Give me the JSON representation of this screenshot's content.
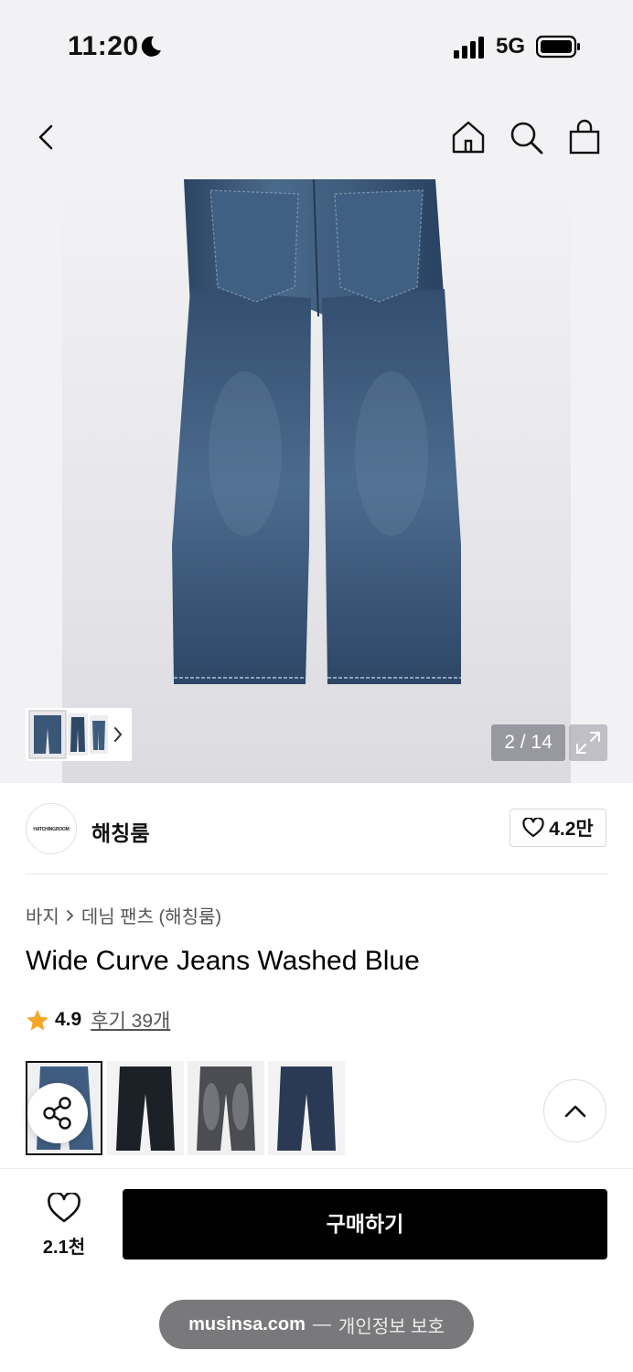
{
  "status_bar": {
    "time": "11:20",
    "network": "5G"
  },
  "nav": {
    "back": "back",
    "home": "home",
    "search": "search",
    "bag": "shopping-bag"
  },
  "gallery": {
    "page_counter": "2 / 14",
    "current": 2,
    "total": 14
  },
  "brand": {
    "logo_text": "HATCHINGROOM",
    "name": "해칭룸",
    "likes": "4.2만"
  },
  "breadcrumb": {
    "category": "바지",
    "subcategory": "데님 팬츠 (해칭룸)"
  },
  "product": {
    "title": "Wide Curve Jeans Washed Blue",
    "rating": "4.9",
    "reviews": "후기 39개"
  },
  "swatches": [
    {
      "name": "washed-blue",
      "selected": true
    },
    {
      "name": "black",
      "selected": false
    },
    {
      "name": "grey",
      "selected": false
    },
    {
      "name": "navy",
      "selected": false
    }
  ],
  "bottom": {
    "like_count": "2.1천",
    "buy_label": "구매하기"
  },
  "browser": {
    "host": "musinsa.com",
    "separator": "—",
    "privacy": "개인정보 보호"
  },
  "colors": {
    "denim": "#3d5878",
    "buy_button": "#000000",
    "star": "#f5a623"
  }
}
